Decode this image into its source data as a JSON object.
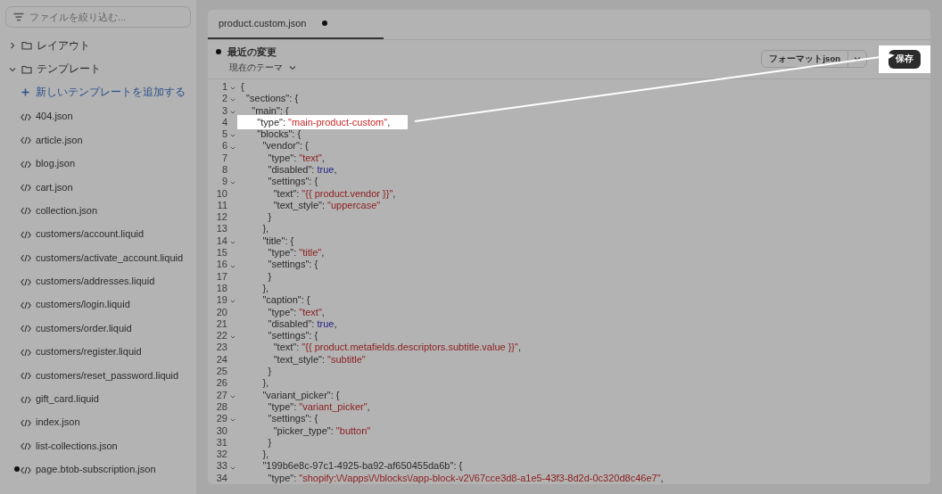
{
  "sidebar": {
    "filter": {
      "placeholder": "ファイルを絞り込む..."
    },
    "tree": [
      {
        "kind": "folder",
        "label": "レイアウト",
        "expanded": false
      },
      {
        "kind": "folder",
        "label": "テンプレート",
        "expanded": true,
        "children": [
          {
            "kind": "add",
            "label": "新しいテンプレートを追加する"
          },
          {
            "kind": "file",
            "label": "404.json",
            "modified": false
          },
          {
            "kind": "file",
            "label": "article.json",
            "modified": false
          },
          {
            "kind": "file",
            "label": "blog.json",
            "modified": false
          },
          {
            "kind": "file",
            "label": "cart.json",
            "modified": false
          },
          {
            "kind": "file",
            "label": "collection.json",
            "modified": false
          },
          {
            "kind": "file",
            "label": "customers/account.liquid",
            "modified": false
          },
          {
            "kind": "file",
            "label": "customers/activate_account.liquid",
            "modified": false
          },
          {
            "kind": "file",
            "label": "customers/addresses.liquid",
            "modified": false
          },
          {
            "kind": "file",
            "label": "customers/login.liquid",
            "modified": false
          },
          {
            "kind": "file",
            "label": "customers/order.liquid",
            "modified": false
          },
          {
            "kind": "file",
            "label": "customers/register.liquid",
            "modified": false
          },
          {
            "kind": "file",
            "label": "customers/reset_password.liquid",
            "modified": false
          },
          {
            "kind": "file",
            "label": "gift_card.liquid",
            "modified": false
          },
          {
            "kind": "file",
            "label": "index.json",
            "modified": false
          },
          {
            "kind": "file",
            "label": "list-collections.json",
            "modified": false
          },
          {
            "kind": "file",
            "label": "page.btob-subscription.json",
            "modified": true
          }
        ]
      }
    ]
  },
  "editor": {
    "tab": {
      "label": "product.custom.json",
      "selected": true,
      "modified": true
    },
    "changes": {
      "title": "最近の変更",
      "theme": "現在のテーマ"
    },
    "format_button": "フォーマットjson",
    "save_button": {
      "label": "保存",
      "highlighted": true
    },
    "lines": [
      {
        "num": "1",
        "fold": true,
        "highlighted": false,
        "parts": [
          {
            "kind": "plain",
            "text": "{"
          }
        ]
      },
      {
        "num": "2",
        "fold": true,
        "highlighted": false,
        "parts": [
          {
            "kind": "plain",
            "text": "  \"sections\": {"
          }
        ]
      },
      {
        "num": "3",
        "fold": true,
        "highlighted": false,
        "parts": [
          {
            "kind": "plain",
            "text": "    \"main\": {"
          }
        ]
      },
      {
        "num": "4",
        "fold": false,
        "highlighted": true,
        "parts": [
          {
            "kind": "plain",
            "text": "      \"type\": "
          },
          {
            "kind": "string",
            "text": "\"main-product-custom\""
          },
          {
            "kind": "plain",
            "text": ","
          }
        ]
      },
      {
        "num": "5",
        "fold": true,
        "highlighted": false,
        "parts": [
          {
            "kind": "plain",
            "text": "      \"blocks\": {"
          }
        ]
      },
      {
        "num": "6",
        "fold": true,
        "highlighted": false,
        "parts": [
          {
            "kind": "plain",
            "text": "        \"vendor\": {"
          }
        ]
      },
      {
        "num": "7",
        "fold": false,
        "highlighted": false,
        "parts": [
          {
            "kind": "plain",
            "text": "          \"type\": "
          },
          {
            "kind": "string",
            "text": "\"text\""
          },
          {
            "kind": "plain",
            "text": ","
          }
        ]
      },
      {
        "num": "8",
        "fold": false,
        "highlighted": false,
        "parts": [
          {
            "kind": "plain",
            "text": "          \"disabled\": "
          },
          {
            "kind": "boolean",
            "text": "true"
          },
          {
            "kind": "plain",
            "text": ","
          }
        ]
      },
      {
        "num": "9",
        "fold": true,
        "highlighted": false,
        "parts": [
          {
            "kind": "plain",
            "text": "          \"settings\": {"
          }
        ]
      },
      {
        "num": "10",
        "fold": false,
        "highlighted": false,
        "parts": [
          {
            "kind": "plain",
            "text": "            \"text\": "
          },
          {
            "kind": "string",
            "text": "\"{{ product.vendor }}\""
          },
          {
            "kind": "plain",
            "text": ","
          }
        ]
      },
      {
        "num": "11",
        "fold": false,
        "highlighted": false,
        "parts": [
          {
            "kind": "plain",
            "text": "            \"text_style\": "
          },
          {
            "kind": "string",
            "text": "\"uppercase\""
          }
        ]
      },
      {
        "num": "12",
        "fold": false,
        "highlighted": false,
        "parts": [
          {
            "kind": "plain",
            "text": "          }"
          }
        ]
      },
      {
        "num": "13",
        "fold": false,
        "highlighted": false,
        "parts": [
          {
            "kind": "plain",
            "text": "        },"
          }
        ]
      },
      {
        "num": "14",
        "fold": true,
        "highlighted": false,
        "parts": [
          {
            "kind": "plain",
            "text": "        \"title\": {"
          }
        ]
      },
      {
        "num": "15",
        "fold": false,
        "highlighted": false,
        "parts": [
          {
            "kind": "plain",
            "text": "          \"type\": "
          },
          {
            "kind": "string",
            "text": "\"title\""
          },
          {
            "kind": "plain",
            "text": ","
          }
        ]
      },
      {
        "num": "16",
        "fold": true,
        "highlighted": false,
        "parts": [
          {
            "kind": "plain",
            "text": "          \"settings\": {"
          }
        ]
      },
      {
        "num": "17",
        "fold": false,
        "highlighted": false,
        "parts": [
          {
            "kind": "plain",
            "text": "          }"
          }
        ]
      },
      {
        "num": "18",
        "fold": false,
        "highlighted": false,
        "parts": [
          {
            "kind": "plain",
            "text": "        },"
          }
        ]
      },
      {
        "num": "19",
        "fold": true,
        "highlighted": false,
        "parts": [
          {
            "kind": "plain",
            "text": "        \"caption\": {"
          }
        ]
      },
      {
        "num": "20",
        "fold": false,
        "highlighted": false,
        "parts": [
          {
            "kind": "plain",
            "text": "          \"type\": "
          },
          {
            "kind": "string",
            "text": "\"text\""
          },
          {
            "kind": "plain",
            "text": ","
          }
        ]
      },
      {
        "num": "21",
        "fold": false,
        "highlighted": false,
        "parts": [
          {
            "kind": "plain",
            "text": "          \"disabled\": "
          },
          {
            "kind": "boolean",
            "text": "true"
          },
          {
            "kind": "plain",
            "text": ","
          }
        ]
      },
      {
        "num": "22",
        "fold": true,
        "highlighted": false,
        "parts": [
          {
            "kind": "plain",
            "text": "          \"settings\": {"
          }
        ]
      },
      {
        "num": "23",
        "fold": false,
        "highlighted": false,
        "parts": [
          {
            "kind": "plain",
            "text": "            \"text\": "
          },
          {
            "kind": "string",
            "text": "\"{{ product.metafields.descriptors.subtitle.value }}\""
          },
          {
            "kind": "plain",
            "text": ","
          }
        ]
      },
      {
        "num": "24",
        "fold": false,
        "highlighted": false,
        "parts": [
          {
            "kind": "plain",
            "text": "            \"text_style\": "
          },
          {
            "kind": "string",
            "text": "\"subtitle\""
          }
        ]
      },
      {
        "num": "25",
        "fold": false,
        "highlighted": false,
        "parts": [
          {
            "kind": "plain",
            "text": "          }"
          }
        ]
      },
      {
        "num": "26",
        "fold": false,
        "highlighted": false,
        "parts": [
          {
            "kind": "plain",
            "text": "        },"
          }
        ]
      },
      {
        "num": "27",
        "fold": true,
        "highlighted": false,
        "parts": [
          {
            "kind": "plain",
            "text": "        \"variant_picker\": {"
          }
        ]
      },
      {
        "num": "28",
        "fold": false,
        "highlighted": false,
        "parts": [
          {
            "kind": "plain",
            "text": "          \"type\": "
          },
          {
            "kind": "string",
            "text": "\"variant_picker\""
          },
          {
            "kind": "plain",
            "text": ","
          }
        ]
      },
      {
        "num": "29",
        "fold": true,
        "highlighted": false,
        "parts": [
          {
            "kind": "plain",
            "text": "          \"settings\": {"
          }
        ]
      },
      {
        "num": "30",
        "fold": false,
        "highlighted": false,
        "parts": [
          {
            "kind": "plain",
            "text": "            \"picker_type\": "
          },
          {
            "kind": "string",
            "text": "\"button\""
          }
        ]
      },
      {
        "num": "31",
        "fold": false,
        "highlighted": false,
        "parts": [
          {
            "kind": "plain",
            "text": "          }"
          }
        ]
      },
      {
        "num": "32",
        "fold": false,
        "highlighted": false,
        "parts": [
          {
            "kind": "plain",
            "text": "        },"
          }
        ]
      },
      {
        "num": "33",
        "fold": true,
        "highlighted": false,
        "parts": [
          {
            "kind": "plain",
            "text": "        \"199b6e8c-97c1-4925-ba92-af650455da6b\": {"
          }
        ]
      },
      {
        "num": "34",
        "fold": false,
        "highlighted": false,
        "parts": [
          {
            "kind": "plain",
            "text": "          \"type\": "
          },
          {
            "kind": "string",
            "text": "\"shopify:\\/\\/apps\\/\\/blocks\\/app-block-v2\\/67cce3d8-a1e5-43f3-8d2d-0c320d8c46e7\""
          },
          {
            "kind": "plain",
            "text": ","
          }
        ]
      }
    ]
  }
}
